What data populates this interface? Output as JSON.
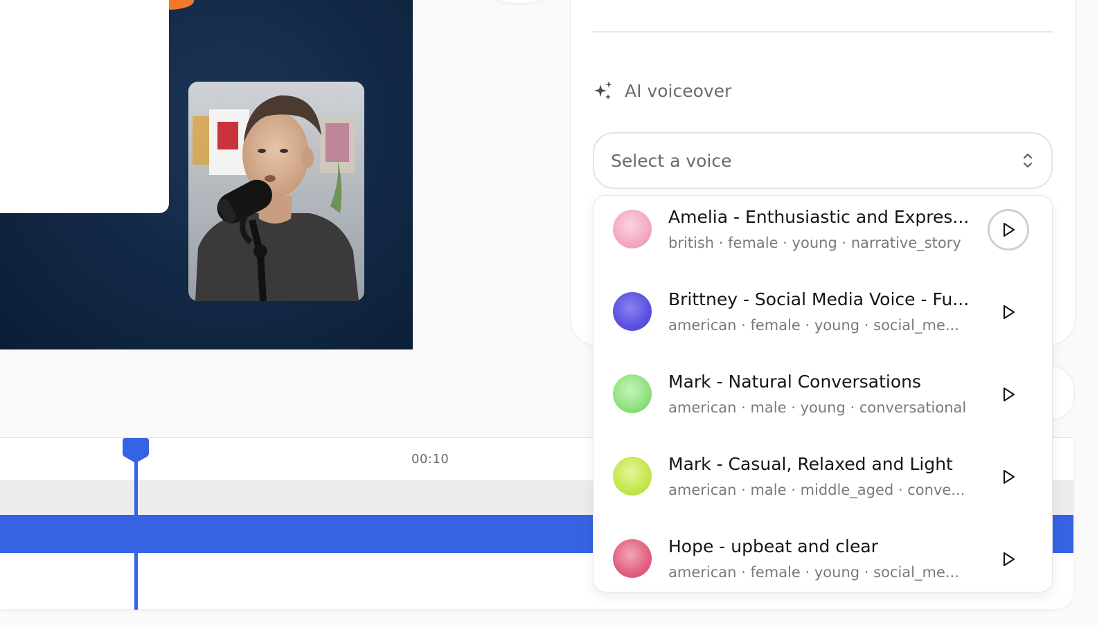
{
  "ai_voiceover": {
    "title": "AI voiceover",
    "icon": "sparkle-icon",
    "select_placeholder": "Select a voice"
  },
  "voices": [
    {
      "name": "Amelia - Enthusiastic and Expres...",
      "meta": "british · female · young · narrative_story",
      "avatar_color": "#f2a9bf",
      "hovered": true
    },
    {
      "name": "Brittney - Social Media Voice - Fu...",
      "meta": "american · female · young · social_me...",
      "avatar_color": "#5b50e0"
    },
    {
      "name": "Mark - Natural Conversations",
      "meta": "american · male · young · conversational",
      "avatar_color": "#8fe07e"
    },
    {
      "name": "Mark - Casual, Relaxed and Light",
      "meta": "american · male · middle_aged · conve...",
      "avatar_color": "#c4e64c"
    },
    {
      "name": "Hope - upbeat and clear",
      "meta": "american · female · young · social_me...",
      "avatar_color": "#e0607f"
    }
  ],
  "timeline": {
    "ruler_label": "00:10"
  },
  "colors": {
    "accent": "#3663e3",
    "preview_bg": "#0f2644",
    "orange": "#f07a2a"
  }
}
